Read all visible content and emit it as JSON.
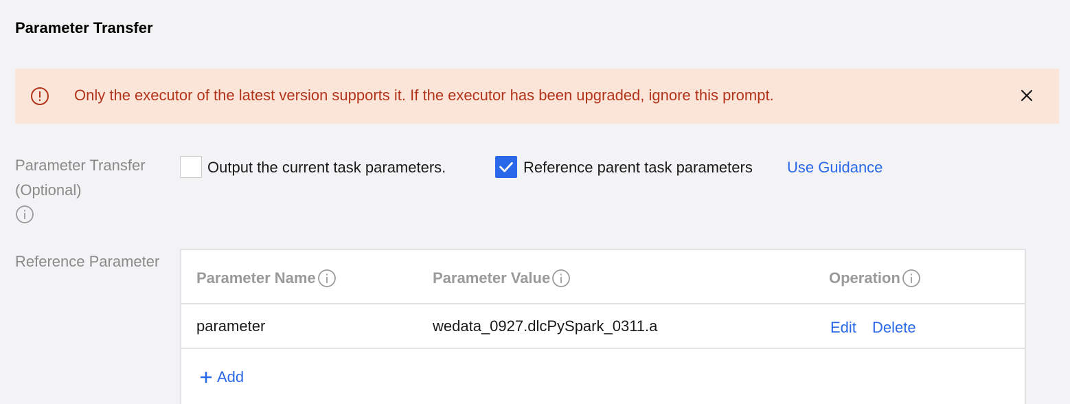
{
  "section": {
    "title": "Parameter Transfer"
  },
  "alert": {
    "icon": "exclamation-circle-icon",
    "message": "Only the executor of the latest version supports it. If the executor has been upgraded, ignore this prompt.",
    "close_icon": "close-icon",
    "colors": {
      "background": "#fbe5d9",
      "text": "#b2341b"
    }
  },
  "transfer": {
    "label": "Parameter Transfer (Optional)",
    "info_icon": "info-icon",
    "output_checkbox": {
      "label": "Output the current task parameters.",
      "checked": false
    },
    "reference_checkbox": {
      "label": "Reference parent task parameters",
      "checked": true
    },
    "guidance_link": "Use Guidance"
  },
  "reference": {
    "label": "Reference Parameter",
    "table": {
      "headers": {
        "name": "Parameter Name",
        "value": "Parameter Value",
        "operation": "Operation"
      },
      "rows": [
        {
          "name": "parameter",
          "value": "wedata_0927.dlcPySpark_0311.a",
          "edit": "Edit",
          "delete": "Delete"
        }
      ],
      "add_label": "Add"
    }
  },
  "colors": {
    "accent": "#2968e8",
    "muted": "#8a8a8a"
  }
}
